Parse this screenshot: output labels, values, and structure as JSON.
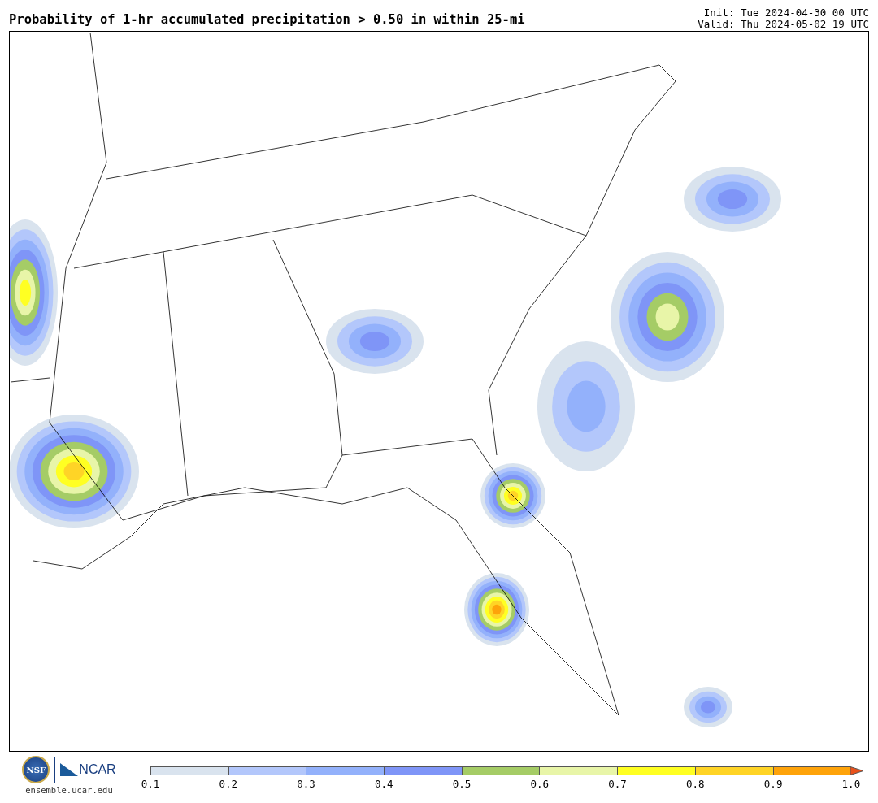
{
  "title": "Probability of 1-hr accumulated precipitation > 0.50 in within 25-mi",
  "init": "Init: Tue 2024-04-30 00 UTC",
  "valid": "Valid: Thu 2024-05-02 19 UTC",
  "logos": {
    "nsf": "NSF",
    "ncar": "NCAR",
    "url": "ensemble.ucar.edu"
  },
  "colorbar": {
    "bins": [
      {
        "color": "#d9e3ee"
      },
      {
        "color": "#b3c7fb"
      },
      {
        "color": "#93b1fb"
      },
      {
        "color": "#7f95f7"
      },
      {
        "color": "#a5cc66"
      },
      {
        "color": "#e8f5a8"
      },
      {
        "color": "#ffff22"
      },
      {
        "color": "#ffd426"
      },
      {
        "color": "#fea30a"
      }
    ],
    "extend_arrow": {
      "color": "#e9511b"
    },
    "ticks": [
      "0.1",
      "0.2",
      "0.3",
      "0.4",
      "0.5",
      "0.6",
      "0.7",
      "0.8",
      "0.9",
      "1.0"
    ]
  }
}
